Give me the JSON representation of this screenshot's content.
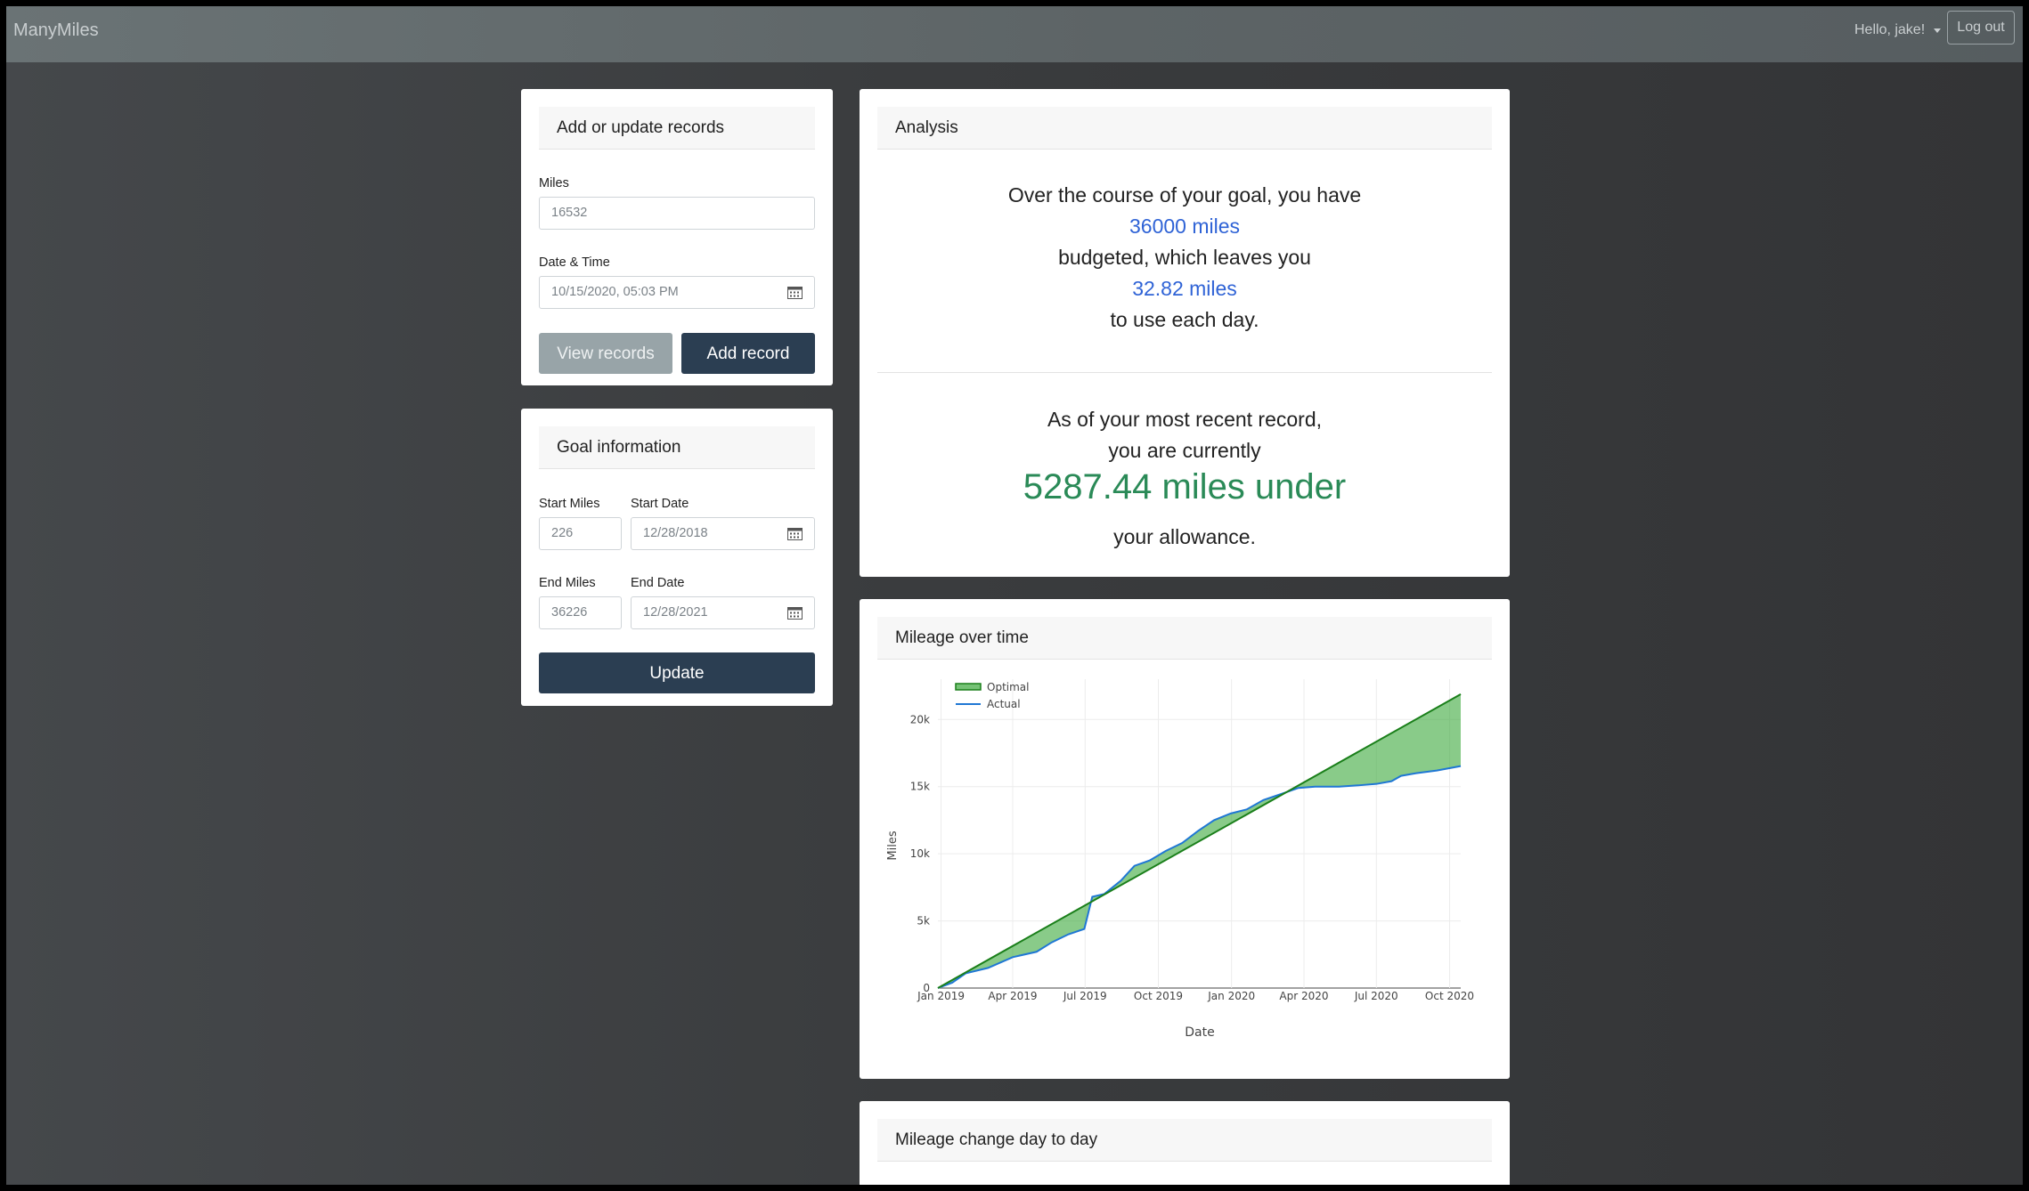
{
  "navbar": {
    "brand": "ManyMiles",
    "greeting": "Hello, jake!",
    "logout_label": "Log out"
  },
  "records_card": {
    "title": "Add or update records",
    "miles_label": "Miles",
    "miles_placeholder": "16532",
    "datetime_label": "Date & Time",
    "datetime_value": "10/15/2020, 05:03 PM",
    "view_records_label": "View records",
    "add_record_label": "Add record"
  },
  "goal_card": {
    "title": "Goal information",
    "start_miles_label": "Start Miles",
    "start_miles_value": "226",
    "start_date_label": "Start Date",
    "start_date_value": "12/28/2018",
    "end_miles_label": "End Miles",
    "end_miles_value": "36226",
    "end_date_label": "End Date",
    "end_date_value": "12/28/2021",
    "update_label": "Update"
  },
  "analysis": {
    "title": "Analysis",
    "line1": "Over the course of your goal, you have",
    "budget_value": "36000 miles",
    "line2": "budgeted, which leaves you",
    "daily_value": "32.82 miles",
    "line3": "to use each day.",
    "line4": "As of your most recent record,",
    "line5": "you are currently",
    "status_value": "5287.44 miles under",
    "line6": "your allowance.",
    "status_color": "#2a8a57",
    "value_color": "#2f63d6"
  },
  "mileage_card": {
    "title": "Mileage over time"
  },
  "change_card": {
    "title": "Mileage change day to day"
  },
  "chart_data": {
    "type": "line",
    "xlabel": "Date",
    "ylabel": "Miles",
    "x_ticks": [
      "Jan 2019",
      "Apr 2019",
      "Jul 2019",
      "Oct 2019",
      "Jan 2020",
      "Apr 2020",
      "Jul 2020",
      "Oct 2020"
    ],
    "y_ticks": [
      "0",
      "5k",
      "10k",
      "15k",
      "20k"
    ],
    "ylim": [
      0,
      23000
    ],
    "xlim": [
      "2018-12-28",
      "2020-10-15"
    ],
    "grid": true,
    "legend_position": "top-left",
    "fill": "between Optimal and Actual",
    "series": [
      {
        "name": "Optimal",
        "color": "#1a7f1a",
        "points": [
          [
            "2018-12-28",
            0
          ],
          [
            "2020-10-15",
            21880
          ]
        ]
      },
      {
        "name": "Actual",
        "color": "#1f77d4",
        "points": [
          [
            "2018-12-28",
            0
          ],
          [
            "2019-01-15",
            400
          ],
          [
            "2019-02-01",
            1100
          ],
          [
            "2019-03-01",
            1500
          ],
          [
            "2019-04-01",
            2300
          ],
          [
            "2019-05-01",
            2700
          ],
          [
            "2019-05-20",
            3400
          ],
          [
            "2019-06-10",
            4000
          ],
          [
            "2019-06-30",
            4400
          ],
          [
            "2019-07-10",
            6800
          ],
          [
            "2019-07-25",
            7000
          ],
          [
            "2019-08-15",
            8000
          ],
          [
            "2019-09-01",
            9100
          ],
          [
            "2019-09-20",
            9500
          ],
          [
            "2019-10-10",
            10200
          ],
          [
            "2019-10-31",
            10800
          ],
          [
            "2019-11-20",
            11700
          ],
          [
            "2019-12-10",
            12500
          ],
          [
            "2019-12-31",
            13000
          ],
          [
            "2020-01-20",
            13300
          ],
          [
            "2020-02-10",
            14000
          ],
          [
            "2020-03-01",
            14400
          ],
          [
            "2020-03-25",
            14900
          ],
          [
            "2020-04-15",
            15000
          ],
          [
            "2020-05-15",
            15000
          ],
          [
            "2020-06-10",
            15100
          ],
          [
            "2020-07-01",
            15200
          ],
          [
            "2020-07-20",
            15400
          ],
          [
            "2020-08-01",
            15800
          ],
          [
            "2020-08-20",
            16000
          ],
          [
            "2020-09-15",
            16200
          ],
          [
            "2020-10-15",
            16532
          ]
        ]
      }
    ]
  }
}
